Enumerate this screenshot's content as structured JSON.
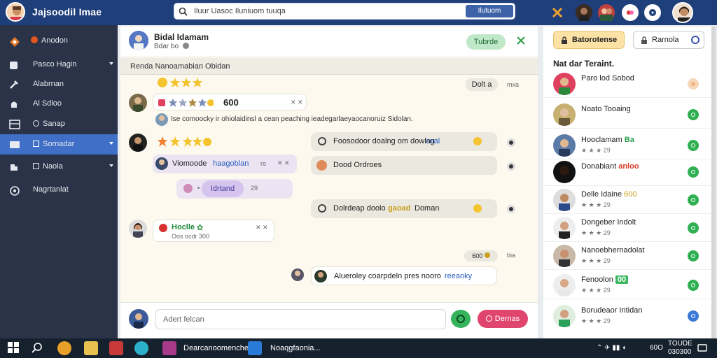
{
  "app": {
    "title": "Jajsoodil Imae"
  },
  "search": {
    "placeholder": "Iluur Uasoc Iluniuom tuuqa",
    "button": "Ilutuom"
  },
  "header_icons": [
    "puzzle-icon",
    "person-icon",
    "people-icon",
    "notification-icon",
    "help-icon"
  ],
  "sidebar": {
    "items": [
      {
        "label": "Anodon",
        "icon": "logo-icon"
      },
      {
        "label": "Pasco Hagin",
        "icon": "folder-icon"
      },
      {
        "label": "Alabrnan",
        "icon": "wrench-icon"
      },
      {
        "label": "Al Sdloo",
        "icon": "hand-icon"
      },
      {
        "label": "Sanap",
        "icon": "grid-icon"
      },
      {
        "label": "Sornadar",
        "icon": "chat-icon",
        "active": true
      },
      {
        "label": "Naola",
        "icon": "puzzle-icon"
      },
      {
        "label": "Nagrtanlat",
        "icon": "globe-icon"
      }
    ]
  },
  "chat": {
    "contact_name": "Bidal Idamam",
    "contact_status": "Bdar bo",
    "call_button": "Tubrde",
    "subheader": "Renda Nanoamabian Obidan",
    "messages": {
      "m1_meta": "600",
      "m1_text": "Ise comoocky ir ohiolaidinsl a cean peaching ieadegarlaeyaocanoruiz Sidolan.",
      "date_right_1": "Dolt a",
      "date_right_1b": "mxa",
      "m2_text": "Viomoode",
      "m2_highlight": "haagoblan",
      "m2_meta": "ro",
      "m3_pill": "Idrtand",
      "m3_meta": "29",
      "r1_text": "Foosodoor doalng om dowlag",
      "r1_highlight": "coal",
      "r2_text": "Dood Ordroes",
      "r3_text": "Dolrdeap doolo",
      "r3_highlight": "gaoad",
      "r3_tail": "Doman",
      "m4_name": "Hoclle",
      "m4_meta": "Oos ocdr 300",
      "date_right_2": "600",
      "date_right_2b": "bia",
      "r4_text": "Alueroley coarpdeln pres nooro",
      "r4_highlight": "reeaoky"
    },
    "input_placeholder": "Adert felcan",
    "send_button": "Dernas"
  },
  "right_panel": {
    "tab_active": "Batorotense",
    "tab_other": "Rarnola",
    "title": "Nat dar Teraint.",
    "contacts": [
      {
        "name": "Paro lod Sobod",
        "stars": "",
        "indicator": "peach"
      },
      {
        "name": "Noato Tooaing",
        "stars": "",
        "indicator": "green"
      },
      {
        "name": "Hooclamam",
        "badge": "Ba",
        "stars": "★ ★ ★ 29",
        "indicator": "green"
      },
      {
        "name": "Donabiant",
        "badge": "anloo",
        "stars": "",
        "indicator": "green"
      },
      {
        "name": "Delle Idaine",
        "badge": "600",
        "stars": "★ ★ ★ 29",
        "indicator": "green"
      },
      {
        "name": "Dongeber Indolt",
        "stars": "★ ★ ★ 29",
        "indicator": "green"
      },
      {
        "name": "Nanoebhernadolat",
        "stars": "★ ★ ★ 29",
        "indicator": "green"
      },
      {
        "name": "Fenoolon",
        "badge": "00",
        "stars": "★ ★ ★ 29",
        "indicator": "green"
      },
      {
        "name": "Borudeaor Intidan",
        "stars": "★ ★ ★ 29",
        "indicator": "blue"
      }
    ]
  },
  "taskbar": {
    "app1": "Dearcanoomenche",
    "app2": "Noaqgfaonia...",
    "clock_time": "TOUDE",
    "clock_date": "030300",
    "tray_text": "60O"
  },
  "colors": {
    "topbar": "#1f3f7a",
    "sidebar": "#2a3347",
    "active": "#3f6fc6",
    "send": "#e0456e",
    "accent_green": "#36b45c"
  }
}
